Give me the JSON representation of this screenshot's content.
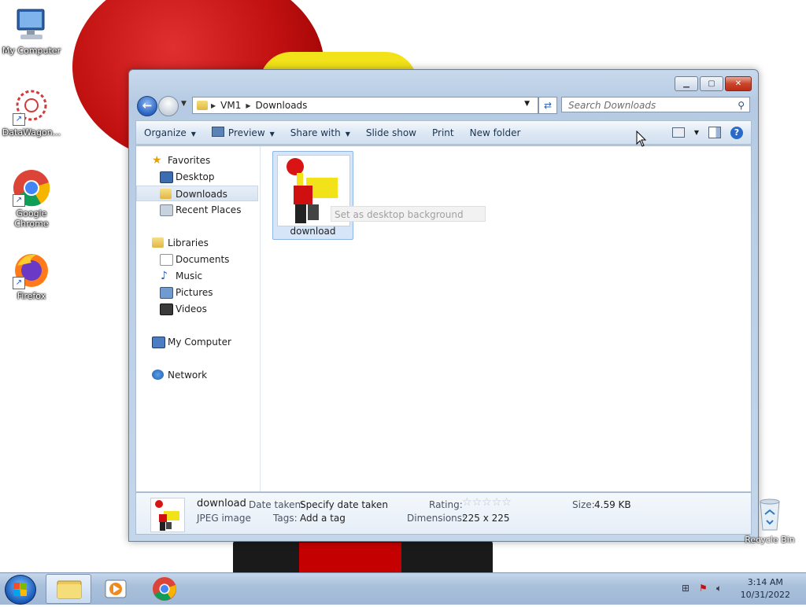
{
  "desktop": {
    "icons": [
      {
        "label": "My Computer"
      },
      {
        "label": "DataWagon..."
      },
      {
        "label": "Google Chrome"
      },
      {
        "label": "Firefox"
      },
      {
        "label": "Recycle Bin"
      }
    ]
  },
  "window": {
    "address": {
      "root": "VM1",
      "current": "Downloads"
    },
    "search_placeholder": "Search Downloads",
    "toolbar": {
      "organize": "Organize",
      "preview": "Preview",
      "share": "Share with",
      "slideshow": "Slide show",
      "print": "Print",
      "new_folder": "New folder"
    },
    "nav": {
      "favorites": "Favorites",
      "desktop": "Desktop",
      "downloads": "Downloads",
      "recent": "Recent Places",
      "libraries": "Libraries",
      "documents": "Documents",
      "music": "Music",
      "pictures": "Pictures",
      "videos": "Videos",
      "computer": "My Computer",
      "network": "Network"
    },
    "file": {
      "name": "download"
    },
    "tooltip": "Set as desktop background",
    "details": {
      "name": "download",
      "type": "JPEG image",
      "date_label": "Date taken:",
      "date_value": "Specify date taken",
      "tags_label": "Tags:",
      "tags_value": "Add a tag",
      "rating_label": "Rating:",
      "rating_value": 0,
      "dimensions_label": "Dimensions:",
      "dimensions_value": "225 x 225",
      "size_label": "Size:",
      "size_value": "4.59 KB"
    }
  },
  "taskbar": {
    "time": "3:14 AM",
    "date": "10/31/2022"
  }
}
